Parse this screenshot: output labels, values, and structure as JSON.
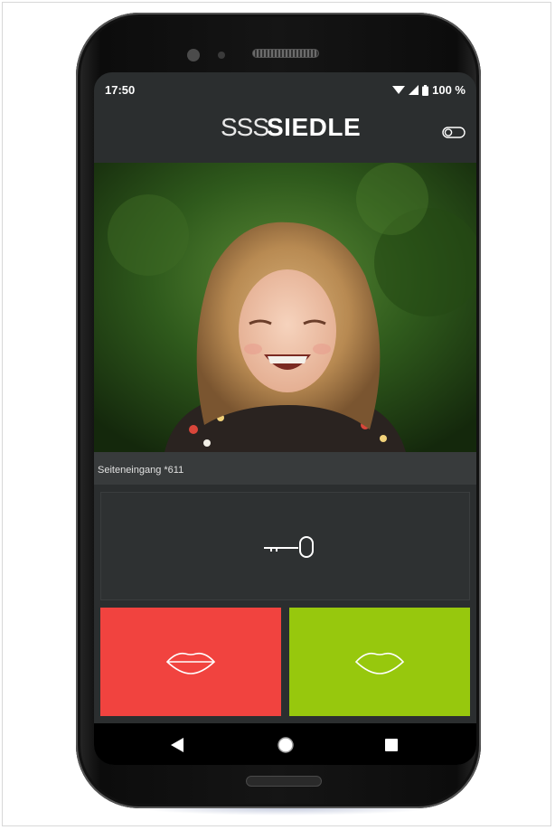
{
  "status_bar": {
    "time": "17:50",
    "battery": "100 %",
    "icons": [
      "wifi-icon",
      "signal-icon",
      "battery-icon"
    ]
  },
  "app_bar": {
    "logo_mark": "SSS",
    "logo_text": "SIEDLE",
    "settings_icon": "toggle-switch-icon"
  },
  "video": {
    "subject": "smiling child with curly hair in front of green hedge",
    "caption": "Seiteneingang *611"
  },
  "actions": {
    "door_open_icon": "key-icon",
    "reject_icon": "lips-icon",
    "accept_icon": "lips-icon"
  },
  "colors": {
    "screen_background": "#2b2e2f",
    "reject": "#f1433f",
    "accept": "#97c80d",
    "navbar": "#000000"
  },
  "navigation": {
    "items": [
      "back-icon",
      "home-icon",
      "recent-apps-icon"
    ]
  }
}
